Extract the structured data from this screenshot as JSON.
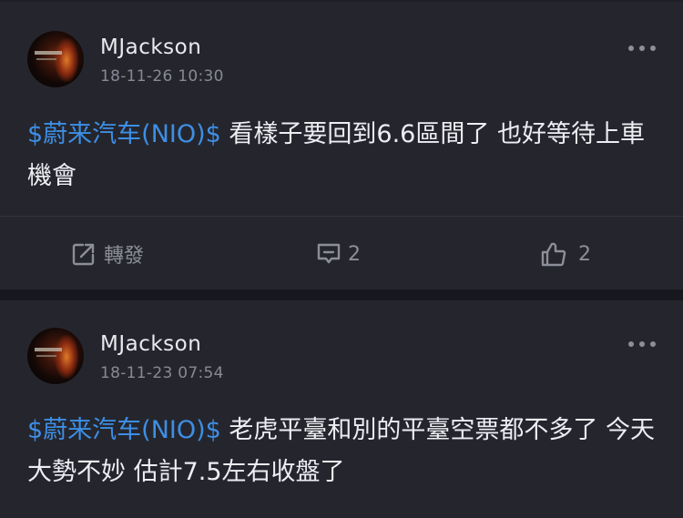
{
  "posts": [
    {
      "username": "MJackson",
      "timestamp": "18-11-26 10:30",
      "tag": "$蔚来汽车(NIO)$",
      "text": " 看樣子要回到6.6區間了 也好等待上車機會",
      "actions": {
        "repost_label": "轉發",
        "comment_count": "2",
        "like_count": "2"
      }
    },
    {
      "username": "MJackson",
      "timestamp": "18-11-23 07:54",
      "tag": "$蔚来汽车(NIO)$",
      "text": " 老虎平臺和別的平臺空票都不多了 今天大勢不妙 估計7.5左右收盤了"
    }
  ],
  "icons": {
    "avatar": "profile-photo",
    "more": "more-dots-icon",
    "repost": "repost-icon",
    "comment": "comment-icon",
    "like": "thumbs-up-icon"
  },
  "colors": {
    "background": "#1b1c22",
    "card": "#25262d",
    "tag": "#3d8fe6",
    "muted": "#878995"
  }
}
